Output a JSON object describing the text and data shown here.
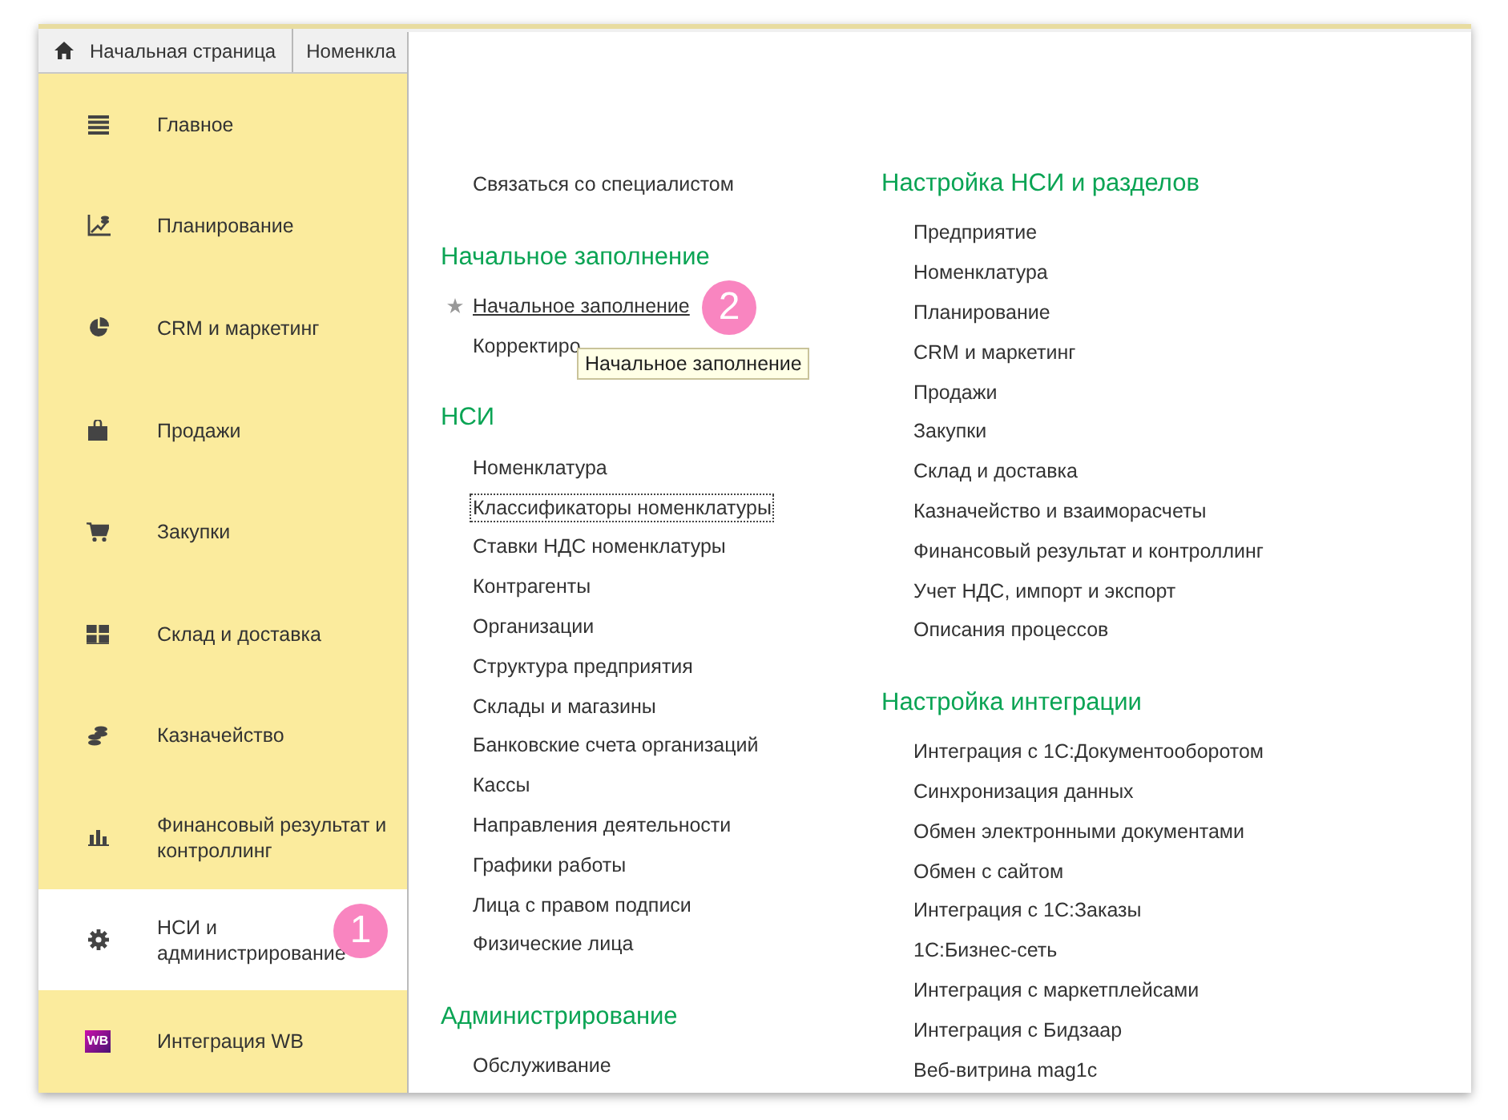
{
  "tabs": [
    {
      "label": "Начальная страница"
    },
    {
      "label": "Номенкла"
    }
  ],
  "sidebar": {
    "items": [
      {
        "label": "Главное",
        "selected": false
      },
      {
        "label": "Планирование",
        "selected": false
      },
      {
        "label": "CRM и маркетинг",
        "selected": false
      },
      {
        "label": "Продажи",
        "selected": false
      },
      {
        "label": "Закупки",
        "selected": false
      },
      {
        "label": "Склад и доставка",
        "selected": false
      },
      {
        "label": "Казначейство",
        "selected": false
      },
      {
        "label": "Финансовый результат и контроллинг",
        "selected": false
      },
      {
        "label": "НСИ и администрирование",
        "selected": true
      },
      {
        "label": "Интеграция WB",
        "selected": false,
        "badge": "WB"
      }
    ]
  },
  "panel": {
    "columns": [
      {
        "sections": [
          {
            "items": [
              {
                "label": "Связаться со специалистом",
                "focused": false,
                "hovered": false
              }
            ]
          },
          {
            "heading": "Начальное заполнение",
            "items": [
              {
                "label": "Начальное заполнение",
                "focused": false,
                "hovered": true,
                "starred": true
              },
              {
                "label": "Корректиро",
                "focused": false,
                "hovered": false
              }
            ]
          },
          {
            "heading": "НСИ",
            "items": [
              {
                "label": "Номенклатура",
                "focused": false,
                "hovered": false
              },
              {
                "label": "Классификаторы номенклатуры",
                "focused": true,
                "hovered": false
              },
              {
                "label": "Ставки НДС номенклатуры",
                "focused": false,
                "hovered": false
              },
              {
                "label": "Контрагенты",
                "focused": false,
                "hovered": false
              },
              {
                "label": "Организации",
                "focused": false,
                "hovered": false
              },
              {
                "label": "Структура предприятия",
                "focused": false,
                "hovered": false
              },
              {
                "label": "Склады и магазины",
                "focused": false,
                "hovered": false
              },
              {
                "label": "Банковские счета организаций",
                "focused": false,
                "hovered": false
              },
              {
                "label": "Кассы",
                "focused": false,
                "hovered": false
              },
              {
                "label": "Направления деятельности",
                "focused": false,
                "hovered": false
              },
              {
                "label": "Графики работы",
                "focused": false,
                "hovered": false
              },
              {
                "label": "Лица с правом подписи",
                "focused": false,
                "hovered": false
              },
              {
                "label": "Физические лица",
                "focused": false,
                "hovered": false
              }
            ]
          },
          {
            "heading": "Администрирование",
            "items": [
              {
                "label": "Обслуживание",
                "focused": false,
                "hovered": false
              }
            ]
          }
        ]
      },
      {
        "sections": [
          {
            "heading": "Настройка НСИ и разделов",
            "items": [
              {
                "label": "Предприятие",
                "focused": false,
                "hovered": false
              },
              {
                "label": "Номенклатура",
                "focused": false,
                "hovered": false
              },
              {
                "label": "Планирование",
                "focused": false,
                "hovered": false
              },
              {
                "label": "CRM и маркетинг",
                "focused": false,
                "hovered": false
              },
              {
                "label": "Продажи",
                "focused": false,
                "hovered": false
              },
              {
                "label": "Закупки",
                "focused": false,
                "hovered": false
              },
              {
                "label": "Склад и доставка",
                "focused": false,
                "hovered": false
              },
              {
                "label": "Казначейство и взаиморасчеты",
                "focused": false,
                "hovered": false
              },
              {
                "label": "Финансовый результат и контроллинг",
                "focused": false,
                "hovered": false
              },
              {
                "label": "Учет НДС, импорт и экспорт",
                "focused": false,
                "hovered": false
              },
              {
                "label": "Описания процессов",
                "focused": false,
                "hovered": false
              }
            ]
          },
          {
            "heading": "Настройка интеграции",
            "items": [
              {
                "label": "Интеграция с 1С:Документооборотом",
                "focused": false,
                "hovered": false
              },
              {
                "label": "Синхронизация данных",
                "focused": false,
                "hovered": false
              },
              {
                "label": "Обмен электронными документами",
                "focused": false,
                "hovered": false
              },
              {
                "label": "Обмен с сайтом",
                "focused": false,
                "hovered": false
              },
              {
                "label": "Интеграция с 1С:Заказы",
                "focused": false,
                "hovered": false
              },
              {
                "label": "1С:Бизнес-сеть",
                "focused": false,
                "hovered": false
              },
              {
                "label": "Интеграция с маркетплейсами",
                "focused": false,
                "hovered": false
              },
              {
                "label": "Интеграция с Бидзаар",
                "focused": false,
                "hovered": false
              },
              {
                "label": "Веб-витрина mag1c",
                "focused": false,
                "hovered": false
              }
            ]
          }
        ]
      }
    ]
  },
  "tooltip": {
    "text": "Начальное заполнение"
  },
  "step_badges": [
    {
      "number": "1"
    },
    {
      "number": "2"
    }
  ]
}
